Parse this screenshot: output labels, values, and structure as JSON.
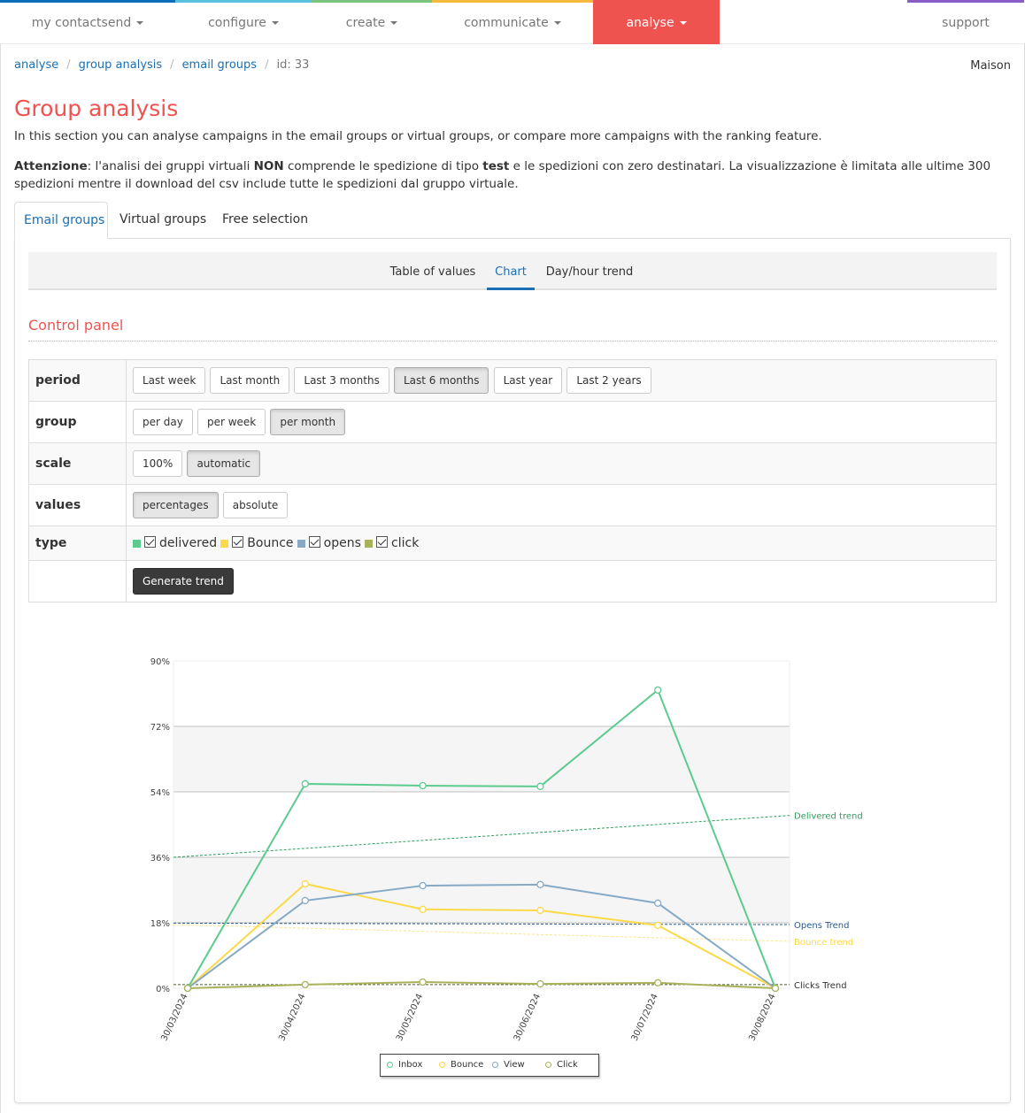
{
  "nav": {
    "items": [
      {
        "label": "my contactsend",
        "color": "#0a6ebd",
        "dropdown": true
      },
      {
        "label": "configure",
        "color": "#5bc0de",
        "dropdown": true
      },
      {
        "label": "create",
        "color": "#7cc47c",
        "dropdown": true
      },
      {
        "label": "communicate",
        "color": "#f6b93b",
        "dropdown": true
      },
      {
        "label": "analyse",
        "color": "#ef5350",
        "dropdown": true,
        "active": true
      },
      {
        "label": "support",
        "color": "#8a5cc8",
        "dropdown": false
      }
    ]
  },
  "breadcrumb": {
    "items": [
      "analyse",
      "group analysis",
      "email groups"
    ],
    "current": "id: 33"
  },
  "user": {
    "name": "Maison"
  },
  "page": {
    "title": "Group analysis",
    "intro": "In this section you can analyse campaigns in the email groups or virtual groups, or compare more campaigns with the ranking feature.",
    "warning": {
      "label": "Attenzione",
      "part1": ": l'analisi dei gruppi virtuali ",
      "bold1": "NON",
      "part2": " comprende le spedizione di tipo ",
      "bold2": "test",
      "part3": " e le spedizioni con zero destinatari. La visualizzazione è limitata alle ultime 300 spedizioni mentre il download del csv include tutte le spedizioni dal gruppo virtuale."
    }
  },
  "tabs": [
    {
      "label": "Email groups",
      "active": true
    },
    {
      "label": "Virtual groups",
      "active": false
    },
    {
      "label": "Free selection",
      "active": false
    }
  ],
  "subtabs": [
    {
      "label": "Table of values",
      "active": false
    },
    {
      "label": "Chart",
      "active": true
    },
    {
      "label": "Day/hour trend",
      "active": false
    }
  ],
  "control_panel": {
    "title": "Control panel",
    "period": {
      "label": "period",
      "options": [
        "Last week",
        "Last month",
        "Last 3 months",
        "Last 6 months",
        "Last year",
        "Last 2 years"
      ],
      "selected": "Last 6 months"
    },
    "group": {
      "label": "group",
      "options": [
        "per day",
        "per week",
        "per month"
      ],
      "selected": "per month"
    },
    "scale": {
      "label": "scale",
      "options": [
        "100%",
        "automatic"
      ],
      "selected": "automatic"
    },
    "values": {
      "label": "values",
      "options": [
        "percentages",
        "absolute"
      ],
      "selected": "percentages"
    },
    "type": {
      "label": "type",
      "items": [
        {
          "label": "delivered",
          "color": "#5ccb8f",
          "checked": true
        },
        {
          "label": "Bounce",
          "color": "#fcd949",
          "checked": true
        },
        {
          "label": "opens",
          "color": "#86a9c6",
          "checked": true
        },
        {
          "label": "click",
          "color": "#a9b25a",
          "checked": true
        }
      ]
    },
    "generate_label": "Generate trend"
  },
  "chart_data": {
    "type": "line",
    "title": "",
    "xlabel": "",
    "ylabel": "",
    "categories": [
      "30/03/2024",
      "30/04/2024",
      "30/05/2024",
      "30/06/2024",
      "30/07/2024",
      "30/08/2024"
    ],
    "ylim": [
      0,
      90
    ],
    "yticks": [
      "0%",
      "18%",
      "36%",
      "54%",
      "72%",
      "90%"
    ],
    "ytick_values": [
      0,
      18,
      36,
      54,
      72,
      90
    ],
    "grid": true,
    "series": [
      {
        "name": "Inbox",
        "color": "#5ccb8f",
        "values": [
          0,
          56.2,
          55.7,
          55.5,
          82.0,
          0
        ]
      },
      {
        "name": "Bounce",
        "color": "#fcd949",
        "values": [
          0,
          28.7,
          21.7,
          21.4,
          17.3,
          0
        ]
      },
      {
        "name": "View",
        "color": "#86a9c6",
        "values": [
          0,
          24.1,
          28.2,
          28.5,
          23.4,
          0
        ]
      },
      {
        "name": "Click",
        "color": "#a9b25a",
        "values": [
          0,
          1.0,
          1.7,
          1.2,
          1.5,
          0
        ]
      }
    ],
    "trends": [
      {
        "name": "Delivered trend",
        "color": "#2e9e5e",
        "label_color": "#2e9e5e",
        "start": 36.0,
        "end": 47.5
      },
      {
        "name": "Opens Trend",
        "color": "#2a5a8c",
        "label_color": "#2a5a8c",
        "start": 17.9,
        "end": 17.5
      },
      {
        "name": "Bounce trend",
        "color": "#fce58a",
        "label_color": "#fcd949",
        "start": 17.5,
        "end": 12.9
      },
      {
        "name": "Clicks Trend",
        "color": "#4a5a2a",
        "label_color": "#333333",
        "start": 1.0,
        "end": 1.0
      }
    ],
    "legend": {
      "position": "bottom-center",
      "entries": [
        "Inbox",
        "Bounce",
        "View",
        "Click"
      ]
    }
  }
}
